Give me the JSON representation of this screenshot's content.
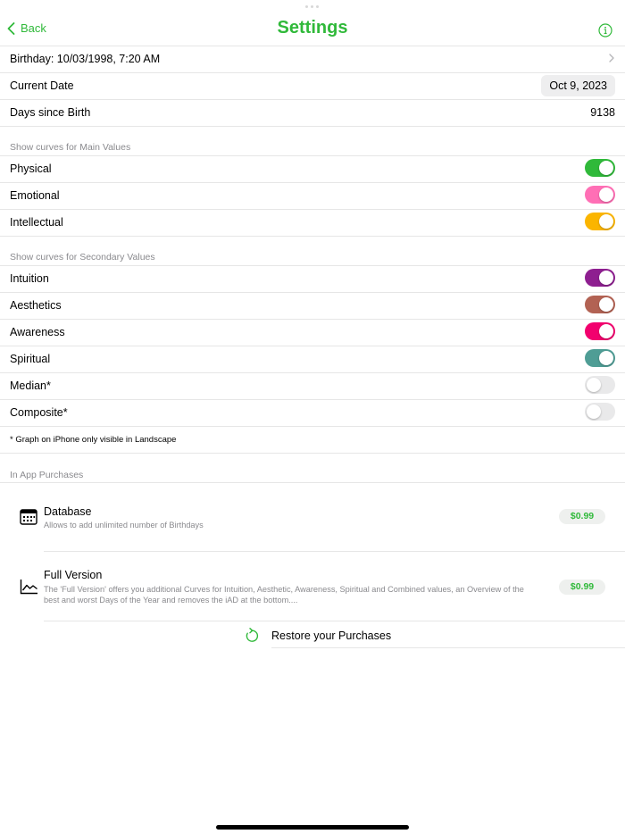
{
  "nav": {
    "back_label": "Back",
    "title": "Settings",
    "info_icon": "info-circle-icon",
    "accent": "#30b93a"
  },
  "general": {
    "birthday": "Birthday: 10/03/1998, 7:20 AM",
    "current_date_label": "Current Date",
    "current_date_value": "Oct 9, 2023",
    "days_label": "Days since Birth",
    "days_value": "9138"
  },
  "main_values": {
    "header": "Show curves for Main Values",
    "items": [
      {
        "label": "Physical",
        "on": true,
        "color": "#30b93a"
      },
      {
        "label": "Emotional",
        "on": true,
        "color": "#ff6fb5"
      },
      {
        "label": "Intellectual",
        "on": true,
        "color": "#fbb500"
      }
    ]
  },
  "secondary_values": {
    "header": "Show curves for Secondary Values",
    "items": [
      {
        "label": "Intuition",
        "on": true,
        "color": "#8e1f90"
      },
      {
        "label": "Aesthetics",
        "on": true,
        "color": "#b26253"
      },
      {
        "label": "Awareness",
        "on": true,
        "color": "#f2006e"
      },
      {
        "label": "Spiritual",
        "on": true,
        "color": "#4f9d95"
      },
      {
        "label": "Median*",
        "on": false,
        "color": "#e9e9ea"
      },
      {
        "label": "Composite*",
        "on": false,
        "color": "#e9e9ea"
      }
    ],
    "footnote": "* Graph on iPhone only visible in Landscape"
  },
  "purchases": {
    "header": "In App Purchases",
    "items": [
      {
        "title": "Database",
        "description": "Allows to add unlimited number of Birthdays",
        "price": "$0.99",
        "icon": "calendar-icon"
      },
      {
        "title": "Full Version",
        "description": "The 'Full Version' offers you additional Curves for Intuition, Aesthetic, Awareness, Spiritual and Combined values, an Overview of the best and worst Days of the Year and removes the iAD at the bottom....",
        "price": "$0.99",
        "icon": "line-chart-icon"
      }
    ],
    "restore_label": "Restore your Purchases",
    "restore_icon": "refresh-icon"
  }
}
